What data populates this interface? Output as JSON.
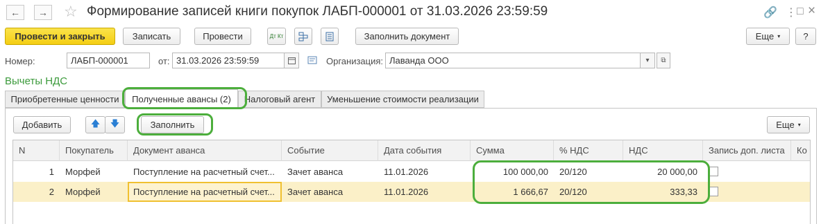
{
  "window": {
    "title": "Формирование записей книги покупок ЛАБП-000001 от 31.03.2026 23:59:59",
    "back_glyph": "←",
    "forward_glyph": "→",
    "star_glyph": "☆",
    "link_glyph": "🔗",
    "menu_glyph": "⋮",
    "maximize_glyph": "□",
    "close_glyph": "×"
  },
  "toolbar": {
    "post_close_label": "Провести и закрыть",
    "save_label": "Записать",
    "post_label": "Провести",
    "dtkt_label": "Дт Кт",
    "fill_doc_label": "Заполнить документ",
    "more_label": "Еще",
    "help_label": "?"
  },
  "header_fields": {
    "number_label": "Номер:",
    "number_value": "ЛАБП-000001",
    "date_label": "от:",
    "date_value": "31.03.2026 23:59:59",
    "org_label": "Организация:",
    "org_value": "Лаванда ООО"
  },
  "section_title": "Вычеты НДС",
  "tabs": [
    {
      "label": "Приобретенные ценности"
    },
    {
      "label": "Полученные авансы (2)"
    },
    {
      "label": "Налоговый агент"
    },
    {
      "label": "Уменьшение стоимости реализации"
    }
  ],
  "tab_toolbar": {
    "add_label": "Добавить",
    "up_glyph": "🡅",
    "down_glyph": "🡇",
    "fill_label": "Заполнить",
    "more_label": "Еще"
  },
  "table": {
    "columns": [
      "N",
      "Покупатель",
      "Документ аванса",
      "Событие",
      "Дата события",
      "Сумма",
      "% НДС",
      "НДС",
      "Запись доп. листа",
      "Ко"
    ],
    "rows": [
      {
        "n": "1",
        "buyer": "Морфей",
        "doc": "Поступление на расчетный счет...",
        "event": "Зачет аванса",
        "date": "11.01.2026",
        "sum": "100 000,00",
        "rate": "20/120",
        "vat": "20 000,00"
      },
      {
        "n": "2",
        "buyer": "Морфей",
        "doc": "Поступление на расчетный счет...",
        "event": "Зачет аванса",
        "date": "11.01.2026",
        "sum": "1 666,67",
        "rate": "20/120",
        "vat": "333,33"
      }
    ]
  },
  "colors": {
    "accent_yellow": "#f4ce14",
    "section_green": "#3b9a3b",
    "highlight_green": "#4cae3c",
    "selected_row": "#fbf0c8"
  }
}
